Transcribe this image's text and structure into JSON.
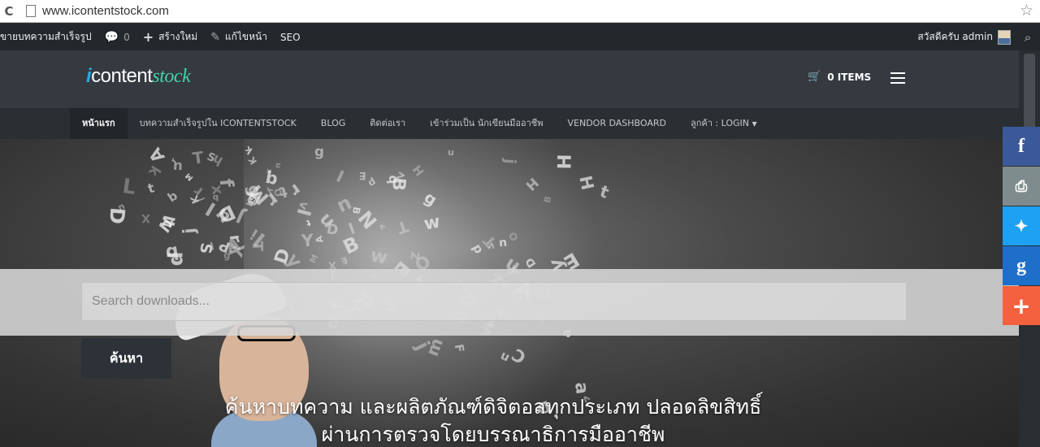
{
  "browser": {
    "url": "www.icontentstock.com",
    "reload_glyph": "C",
    "star_glyph": "☆"
  },
  "admin_bar": {
    "site_name": "ขายบทความสำเร็จรูป",
    "comments_count": "0",
    "new_label": "สร้างใหม่",
    "edit_label": "แก้ไขหน้า",
    "seo_label": "SEO",
    "greeting": "สวัสดีครับ admin"
  },
  "header": {
    "logo": {
      "i": "i",
      "content": "content",
      "stock": "stock"
    },
    "cart_label": "0 ITEMS"
  },
  "nav": {
    "items": [
      {
        "label": "หน้าแรก"
      },
      {
        "label": "บทความสำเร็จรูปใน ICONTENTSTOCK"
      },
      {
        "label": "BLOG"
      },
      {
        "label": "ติดต่อเรา"
      },
      {
        "label": "เข้าร่วมเป็น นักเขียนมืออาชีพ"
      },
      {
        "label": "VENDOR DASHBOARD"
      },
      {
        "label": "ลูกค้า : LOGIN"
      }
    ]
  },
  "search": {
    "placeholder": "Search downloads...",
    "button_label": "ค้นหา"
  },
  "hero": {
    "line1": "ค้นหาบทความ และผลิตภัณฑ์ดิจิตอลทุกประเภท ปลอดลิขสิทธิ์",
    "line2": "ผ่านการตรวจโดยบรรณาธิการมืออาชีพ"
  },
  "share": {
    "facebook": "f",
    "print": "⎙",
    "twitter": "🐦",
    "google": "g",
    "more": "+"
  },
  "icons": {
    "comment": "comment-icon",
    "plus": "plus-icon",
    "pencil": "pencil-icon",
    "cart": "cart-icon",
    "search": "search-icon"
  }
}
